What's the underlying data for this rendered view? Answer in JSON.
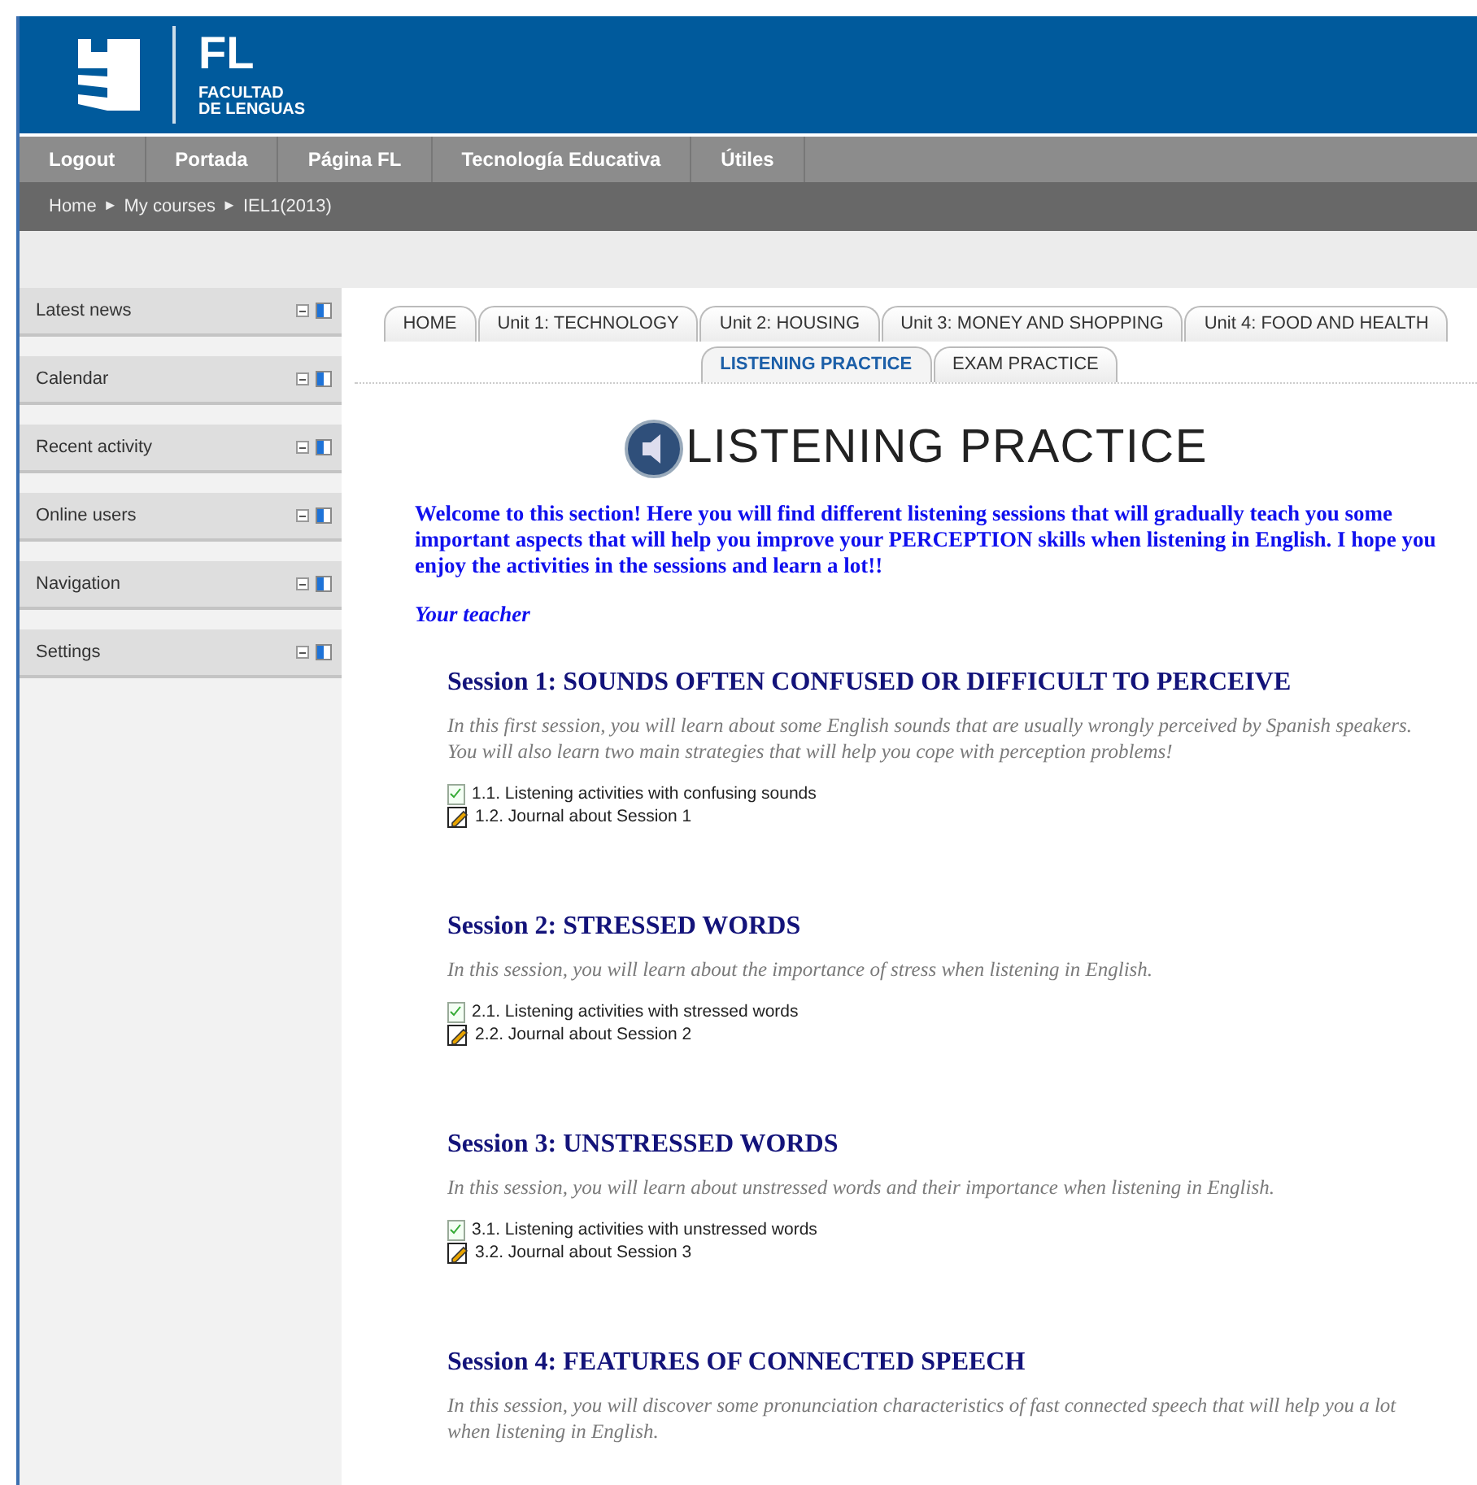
{
  "header": {
    "logo_letters": "FL",
    "logo_line1": "FACULTAD",
    "logo_line2": "DE LENGUAS"
  },
  "menu": [
    "Logout",
    "Portada",
    "Página FL",
    "Tecnología Educativa",
    "Útiles"
  ],
  "breadcrumb": [
    "Home",
    "My courses",
    "IEL1(2013)"
  ],
  "breadcrumb_separator": "►",
  "blocks": [
    "Latest news",
    "Calendar",
    "Recent activity",
    "Online users",
    "Navigation",
    "Settings"
  ],
  "tabs_row1": [
    {
      "label": "HOME",
      "selected": false
    },
    {
      "label": "Unit 1: TECHNOLOGY",
      "selected": false
    },
    {
      "label": "Unit 2: HOUSING",
      "selected": false
    },
    {
      "label": "Unit 3: MONEY AND SHOPPING",
      "selected": false
    },
    {
      "label": "Unit 4: FOOD AND HEALTH",
      "selected": false
    }
  ],
  "tabs_row2": [
    {
      "label": "LISTENING PRACTICE",
      "selected": true
    },
    {
      "label": "EXAM PRACTICE",
      "selected": false
    }
  ],
  "title": "LISTENING PRACTICE",
  "welcome": "Welcome to this section! Here you will find different listening sessions that will gradually teach you some important aspects that will help you improve your PERCEPTION skills when listening in English. I hope you enjoy the activities in the sessions and learn a lot!!",
  "signature": "Your teacher",
  "sessions": [
    {
      "title": "Session 1: SOUNDS OFTEN CONFUSED OR DIFFICULT TO PERCEIVE",
      "description": "In this first session, you will learn about some English sounds that are usually wrongly perceived by Spanish speakers. You will also learn two main strategies that will help you cope with perception problems!",
      "activities": [
        {
          "kind": "quiz",
          "label": "1.1. Listening activities with confusing sounds"
        },
        {
          "kind": "journal",
          "label": "1.2. Journal about Session 1"
        }
      ]
    },
    {
      "title": "Session 2: STRESSED WORDS",
      "description": "In this session, you will learn about the importance of stress when listening in English.",
      "activities": [
        {
          "kind": "quiz",
          "label": "2.1. Listening activities with stressed words"
        },
        {
          "kind": "journal",
          "label": "2.2. Journal about Session 2"
        }
      ]
    },
    {
      "title": "Session 3: UNSTRESSED WORDS",
      "description": "In this session, you will learn about unstressed words and their importance when listening in English.",
      "activities": [
        {
          "kind": "quiz",
          "label": "3.1. Listening activities with unstressed words"
        },
        {
          "kind": "journal",
          "label": "3.2. Journal about Session 3"
        }
      ]
    },
    {
      "title": "Session 4: FEATURES OF CONNECTED SPEECH",
      "description": "In this session, you will discover some pronunciation characteristics of fast connected speech that will help you a lot when listening in English."
    }
  ]
}
